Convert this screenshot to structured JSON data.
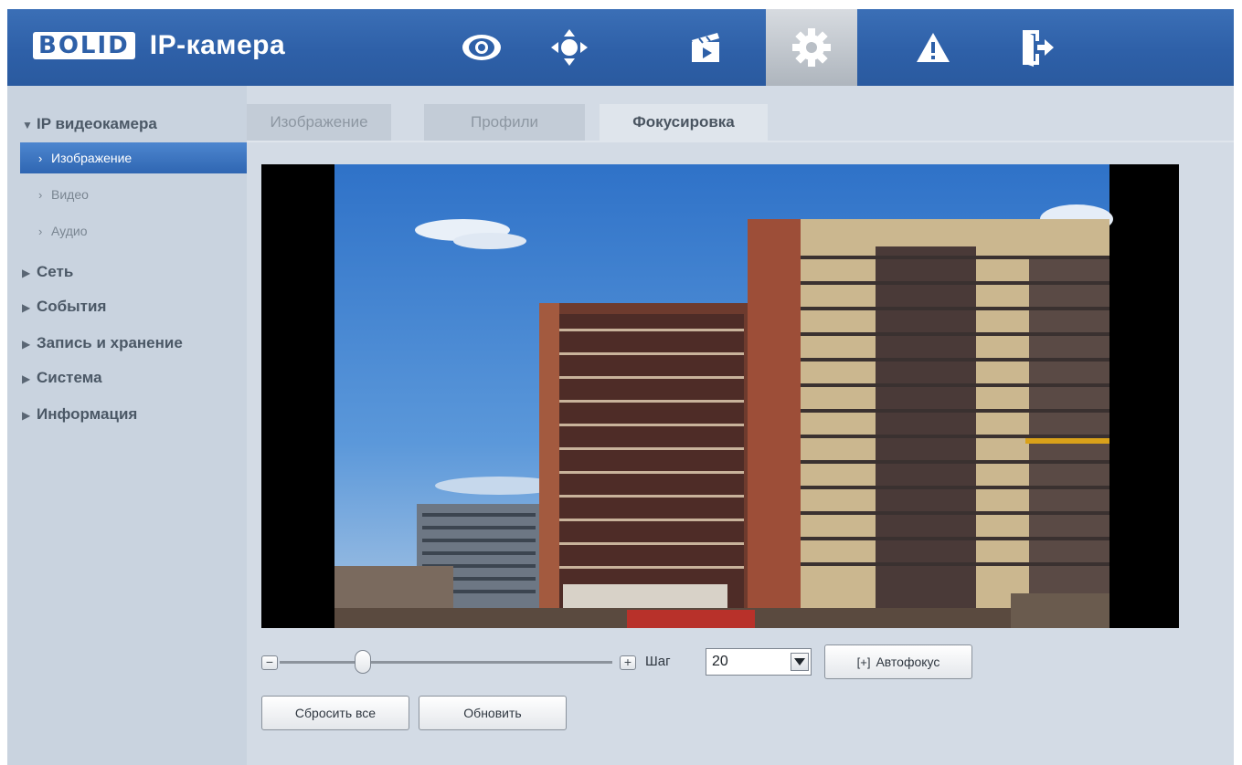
{
  "header": {
    "logo_text": "BOLID",
    "title": "IP-камера",
    "nav_icons": [
      "eye-icon",
      "ptz-icon",
      "playback-icon",
      "settings-icon",
      "alarm-icon",
      "logout-icon"
    ],
    "active_icon": "settings-icon",
    "colors": {
      "background": "#2e60a8",
      "active_tab": "#c8cdd3"
    }
  },
  "sidebar": {
    "root_label": "IP видеокамера",
    "children": [
      {
        "label": "Изображение",
        "selected": true
      },
      {
        "label": "Видео",
        "selected": false
      },
      {
        "label": "Аудио",
        "selected": false
      }
    ],
    "sections": [
      "Сеть",
      "События",
      "Запись и хранение",
      "Система",
      "Информация"
    ]
  },
  "tabs": [
    {
      "label": "Изображение",
      "active": false
    },
    {
      "label": "Профили",
      "active": false
    },
    {
      "label": "Фокусировка",
      "active": true
    }
  ],
  "focus": {
    "minus_label": "−",
    "plus_label": "+",
    "slider_value": 0.25,
    "step_label": "Шаг",
    "step_value": "20",
    "autofocus_label": "Автофокус",
    "reset_label": "Сбросить все",
    "refresh_label": "Обновить"
  }
}
